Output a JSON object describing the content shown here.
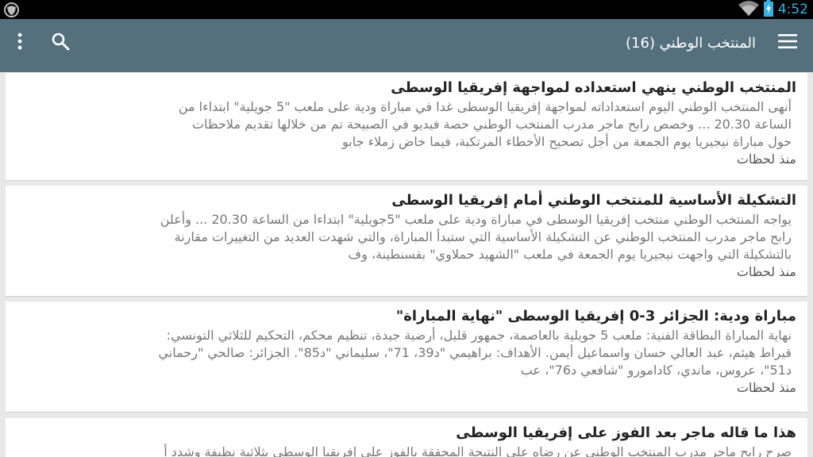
{
  "status_bar": {
    "time": "4:52",
    "icons": [
      "shield-icon",
      "wifi-icon",
      "battery-charging-icon"
    ]
  },
  "toolbar": {
    "title": "المنتخب الوطني (16)",
    "icons": [
      "menu-icon",
      "search-icon",
      "overflow-menu-icon"
    ]
  },
  "articles": [
    {
      "title": "المنتخب الوطني ينهي استعداده لمواجهة إفريقيا الوسطى",
      "lines": [
        "أنهى المنتخب الوطني اليوم استعداداته لمواجهة إفريقيا الوسطى غدا في مباراة ودية على ملعب \"5 جويلية\" ابتداءا من",
        "الساعة 20.30 ... وخصص رابح ماجر مدرب المنتخب الوطني حصة فيديو في الصبيحة تم من خلالها تقديم ملاحظات",
        "حول مباراة نيجيريا يوم الجمعة من أجل تصحيح الأخطاء المرتكبة، فيما خاض زملاء جابو"
      ],
      "time": "منذ لحظات"
    },
    {
      "title": "التشكيلة الأساسية للمنتخب الوطني أمام إفريقيا الوسطى",
      "lines": [
        "يواجه المنتخب الوطني منتخب إفريقيا الوسطى في مباراة ودية على ملعب \"5جويلية\" ابتداءا من الساعة 20.30 ... وأعلن",
        "رابح ماجر مدرب المنتخب الوطني عن التشكيلة الأساسية التي ستبدأ المباراة، والتي شهدت العديد من التغييرات مقارنة",
        "بالتشكيلة التي واجهت نيجيريا يوم الجمعة في ملعب \"الشهيد حملاوي\" بقسنطينة، وف"
      ],
      "time": "منذ لحظات"
    },
    {
      "title": "مباراة ودية: الجزائر 3-0 إفريقيا الوسطى \"نهاية المباراة\"",
      "lines": [
        "نهاية المباراة البطاقة الفنية: ملعب 5 جويلية بالعاصمة، جمهور قليل، أرضية جيدة، تنظيم محكم، التحكيم للثلاثي التونسي:",
        "قيراط هيثم، عبد العالي حسان واسماعيل أيمن. الأهداف: براهيمي \"د39، 71\"، سليماني \"د85\". الجزائر: صالحي \"رحماني",
        "د51\"، عروس، ماندي، كادامورو \"شافعي د76\"، عب"
      ],
      "time": "منذ لحظات"
    },
    {
      "title": "هذا ما قاله ماجر بعد الفوز على إفريقيا الوسطى",
      "lines": [
        "صرح رابح ماجر مدرب المنتخب الوطني عن رضاه على النتيجة المحققة بالفوز على إفريقيا الوسطى بثلاثية نظيفة وشدد أ"
      ],
      "time": ""
    }
  ]
}
